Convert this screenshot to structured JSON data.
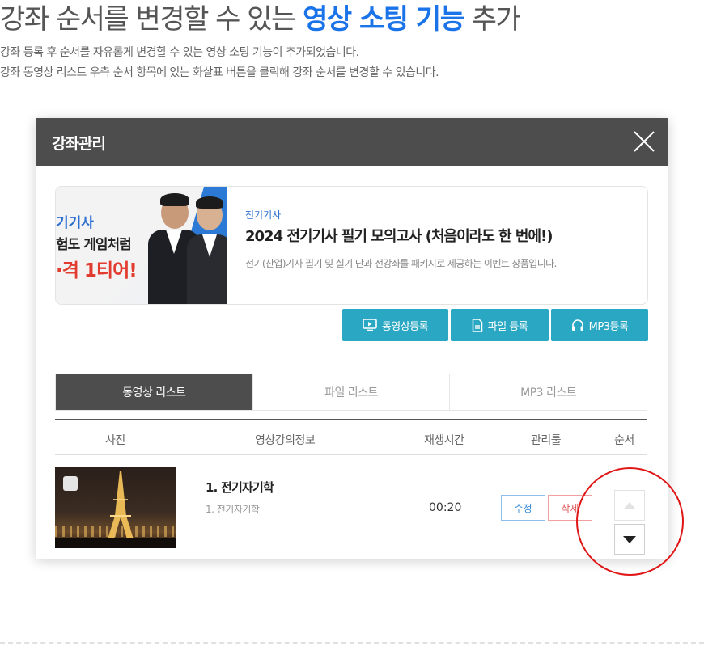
{
  "headline": {
    "prefix": "강좌 순서를 변경할 수 있는 ",
    "highlight": "영상 소팅 기능",
    "suffix": " 추가"
  },
  "description": [
    "강좌 등록 후 순서를 자유롭게 변경할 수 있는 영상 소팅 기능이 추가되었습니다.",
    "강좌 동영상 리스트 우측 순서 항목에 있는 화살표 버튼을 클릭해 강좌 순서를 변경할 수 있습니다."
  ],
  "modal": {
    "title": "강좌관리",
    "product": {
      "banner_lines": [
        "기기사",
        "험도 게임처럼",
        "·격 1티어!"
      ],
      "category": "전기기사",
      "title": "2024 전기기사 필기 모의고사 (처음이라도 한 번에!)",
      "description": "전기(산업)기사 필기 및 실기 단과 전강좌를 패키지로 제공하는 이벤트 상품입니다."
    },
    "buttons": {
      "video_register": "동영상등록",
      "file_register": "파일 등록",
      "mp3_register": "MP3등록"
    },
    "tabs": [
      {
        "label": "동영상 리스트",
        "active": true
      },
      {
        "label": "파일 리스트",
        "active": false
      },
      {
        "label": "MP3 리스트",
        "active": false
      }
    ],
    "table": {
      "headers": [
        "사진",
        "영상강의정보",
        "재생시간",
        "관리툴",
        "순서"
      ],
      "rows": [
        {
          "title": "1. 전기자기학",
          "subtitle": "1. 전기자기학",
          "duration": "00:20",
          "edit_label": "수정",
          "delete_label": "삭제"
        }
      ]
    }
  },
  "colors": {
    "accent": "#1a73e8",
    "header_bg": "#4d4d4d",
    "button_teal": "#2aa7c2",
    "highlight_red": "#e01515"
  },
  "icons": {
    "close": "close-icon",
    "video": "video-icon",
    "file": "file-icon",
    "mp3": "headphones-icon",
    "order_up": "arrow-up-icon",
    "order_down": "arrow-down-icon"
  }
}
